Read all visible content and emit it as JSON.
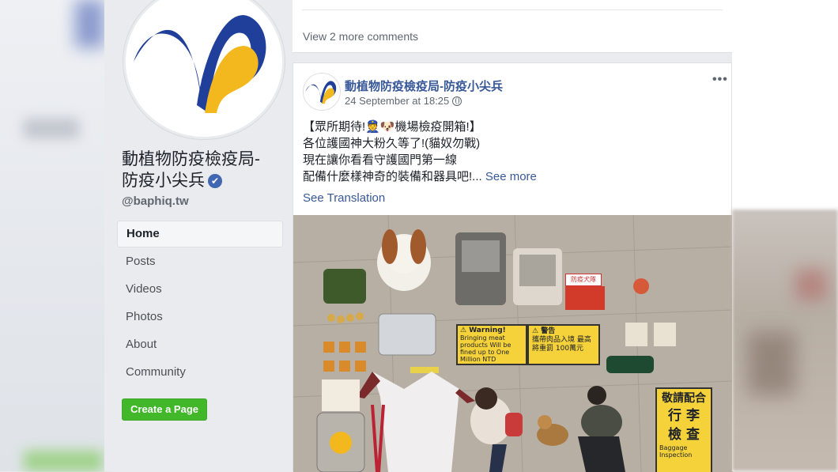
{
  "page": {
    "name_line1": "動植物防疫檢疫局-",
    "name_line2": "防疫小尖兵",
    "verified_badge": "✔",
    "handle": "@baphiq.tw"
  },
  "nav": {
    "items": [
      {
        "label": "Home",
        "active": true
      },
      {
        "label": "Posts"
      },
      {
        "label": "Videos"
      },
      {
        "label": "Photos"
      },
      {
        "label": "About"
      },
      {
        "label": "Community"
      }
    ],
    "create_page": "Create a Page"
  },
  "previous_post": {
    "more_comments": "View 2 more comments"
  },
  "post": {
    "author": "動植物防疫檢疫局-防疫小尖兵",
    "timestamp": "24 September at 18:25",
    "menu": "•••",
    "line1": "【眾所期待!👮🐶機場檢疫開箱!】",
    "line2": "各位護國神大粉久等了!(貓奴勿戰)",
    "line3": "現在讓你看看守護國門第一線",
    "line4": "配備什麼樣神奇的裝備和器具吧!",
    "ellipsis": "...",
    "see_more": "See more",
    "see_translation": "See Translation"
  },
  "photo": {
    "sign1_title": "⚠ Warning!",
    "sign1_body": "Bringing meat products Will be fined up to One Million NTD",
    "sign2_title": "⚠ 警告",
    "sign2_body": "攜帶肉品入境 最高將重罰 100萬元",
    "sign3_line1": "敬請配合",
    "sign3_line2": "行 李",
    "sign3_line3": "檢 查",
    "sign3_sub": "Baggage Inspection",
    "tag": "防疫犬隊"
  },
  "colors": {
    "link": "#385898",
    "create_button": "#42b72a",
    "logo_blue": "#1f3f9a",
    "logo_yellow": "#f2b81e",
    "verified": "#4267b2"
  }
}
